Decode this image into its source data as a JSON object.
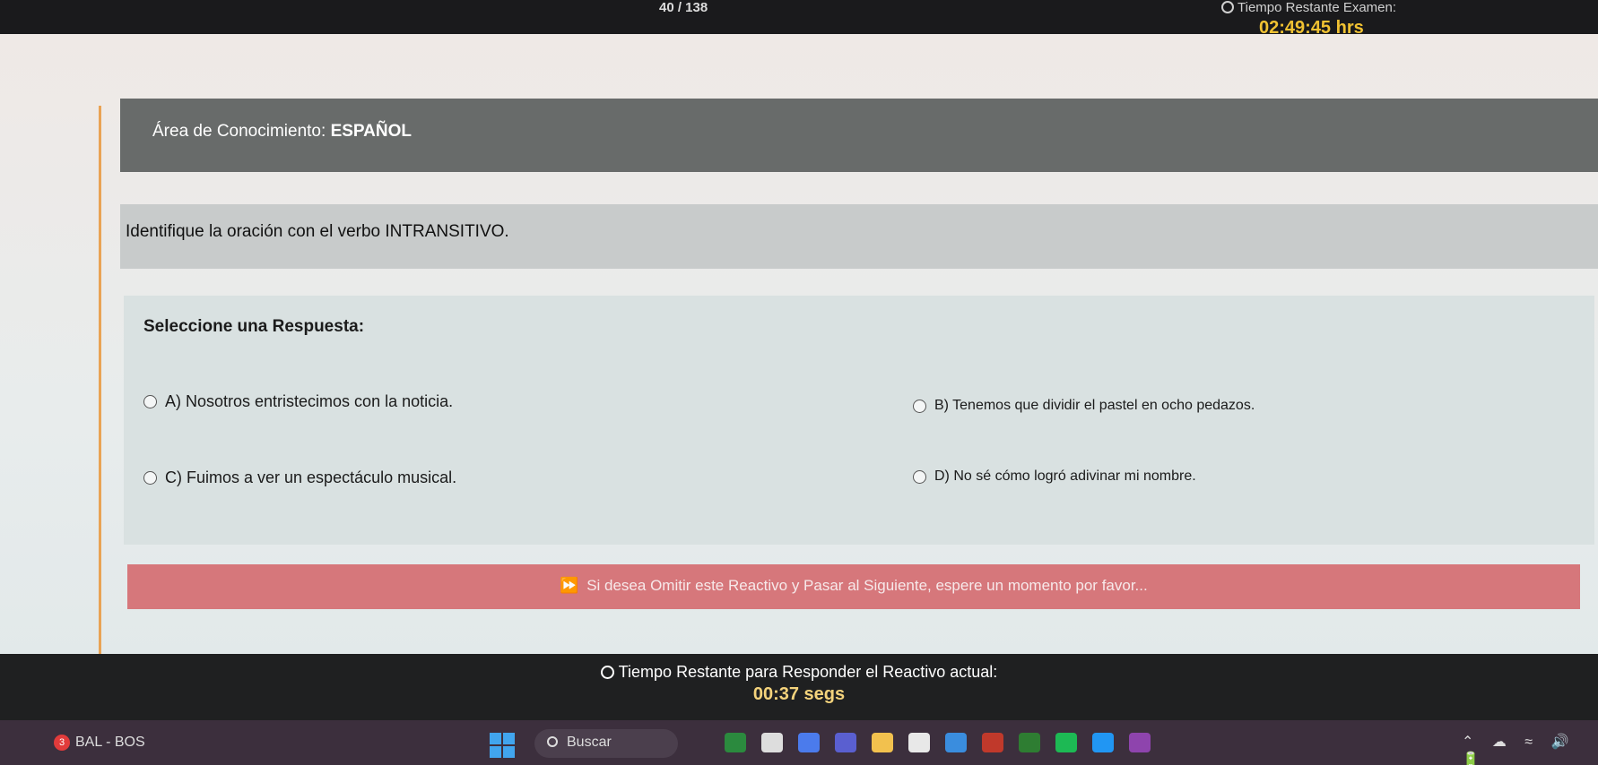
{
  "header": {
    "counter": "40 / 138",
    "exam_time_label": "Tiempo Restante Examen:",
    "exam_time_value": "02:49:45 hrs"
  },
  "area": {
    "label": "Área de Conocimiento:",
    "value": "ESPAÑOL"
  },
  "question": {
    "text": "Identifique la oración con el verbo INTRANSITIVO."
  },
  "answers": {
    "title": "Seleccione una Respuesta:",
    "options": [
      {
        "label": "A) Nosotros entristecimos con la noticia."
      },
      {
        "label": "B) Tenemos que dividir el pastel en ocho pedazos."
      },
      {
        "label": "C) Fuimos a ver un espectáculo musical."
      },
      {
        "label": "D) No sé cómo logró adivinar mi nombre."
      }
    ]
  },
  "skip": {
    "text": "Si desea Omitir este Reactivo y Pasar al Siguiente, espere un momento por favor..."
  },
  "item_timer": {
    "label": "Tiempo Restante para Responder el Reactivo actual:",
    "value": "00:37 segs"
  },
  "taskbar": {
    "weather_badge": "3",
    "weather_text": "BAL - BOS",
    "search_placeholder": "Buscar",
    "app_colors": [
      "#2b8a3e",
      "#dddddd",
      "#4b7bec",
      "#5a5fd0",
      "#f2c14e",
      "#e8e8e8",
      "#3a8dde",
      "#c0392b",
      "#2e7d32",
      "#1db954",
      "#2196f3",
      "#8e44ad"
    ]
  }
}
